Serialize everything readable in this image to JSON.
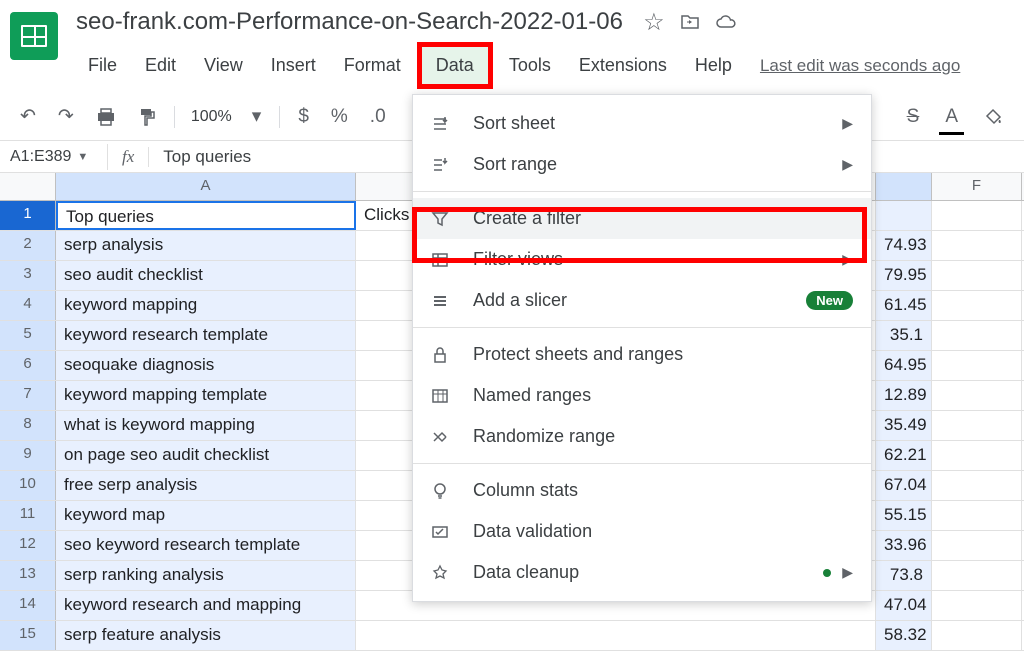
{
  "doc_title": "seo-frank.com-Performance-on-Search-2022-01-06",
  "menubar": [
    "File",
    "Edit",
    "View",
    "Insert",
    "Format",
    "Data",
    "Tools",
    "Extensions",
    "Help"
  ],
  "last_edit": "Last edit was seconds ago",
  "toolbar": {
    "zoom": "100%",
    "currency": "$",
    "percent": "%",
    "decimal": ".0"
  },
  "namebox": "A1:E389",
  "fx_value": "Top queries",
  "columns": {
    "a": "A",
    "f": "F"
  },
  "rows": [
    {
      "n": "1",
      "a": "Top queries",
      "b": "Clicks",
      "e": ""
    },
    {
      "n": "2",
      "a": "serp analysis",
      "b": "",
      "e": "74.93"
    },
    {
      "n": "3",
      "a": "seo audit checklist",
      "b": "",
      "e": "79.95"
    },
    {
      "n": "4",
      "a": "keyword mapping",
      "b": "",
      "e": "61.45"
    },
    {
      "n": "5",
      "a": "keyword research template",
      "b": "",
      "e": "35.1"
    },
    {
      "n": "6",
      "a": "seoquake diagnosis",
      "b": "",
      "e": "64.95"
    },
    {
      "n": "7",
      "a": "keyword mapping template",
      "b": "",
      "e": "12.89"
    },
    {
      "n": "8",
      "a": "what is keyword mapping",
      "b": "",
      "e": "35.49"
    },
    {
      "n": "9",
      "a": "on page seo audit checklist",
      "b": "",
      "e": "62.21"
    },
    {
      "n": "10",
      "a": "free serp analysis",
      "b": "",
      "e": "67.04"
    },
    {
      "n": "11",
      "a": "keyword map",
      "b": "",
      "e": "55.15"
    },
    {
      "n": "12",
      "a": "seo keyword research template",
      "b": "",
      "e": "33.96"
    },
    {
      "n": "13",
      "a": "serp ranking analysis",
      "b": "",
      "e": "73.8"
    },
    {
      "n": "14",
      "a": "keyword research and mapping",
      "b": "",
      "e": "47.04"
    },
    {
      "n": "15",
      "a": "serp feature analysis",
      "b": "",
      "e": "58.32"
    }
  ],
  "dropdown": {
    "sort_sheet": "Sort sheet",
    "sort_range": "Sort range",
    "create_filter": "Create a filter",
    "filter_views": "Filter views",
    "add_slicer": "Add a slicer",
    "new_badge": "New",
    "protect": "Protect sheets and ranges",
    "named_ranges": "Named ranges",
    "randomize": "Randomize range",
    "column_stats": "Column stats",
    "data_validation": "Data validation",
    "data_cleanup": "Data cleanup"
  }
}
